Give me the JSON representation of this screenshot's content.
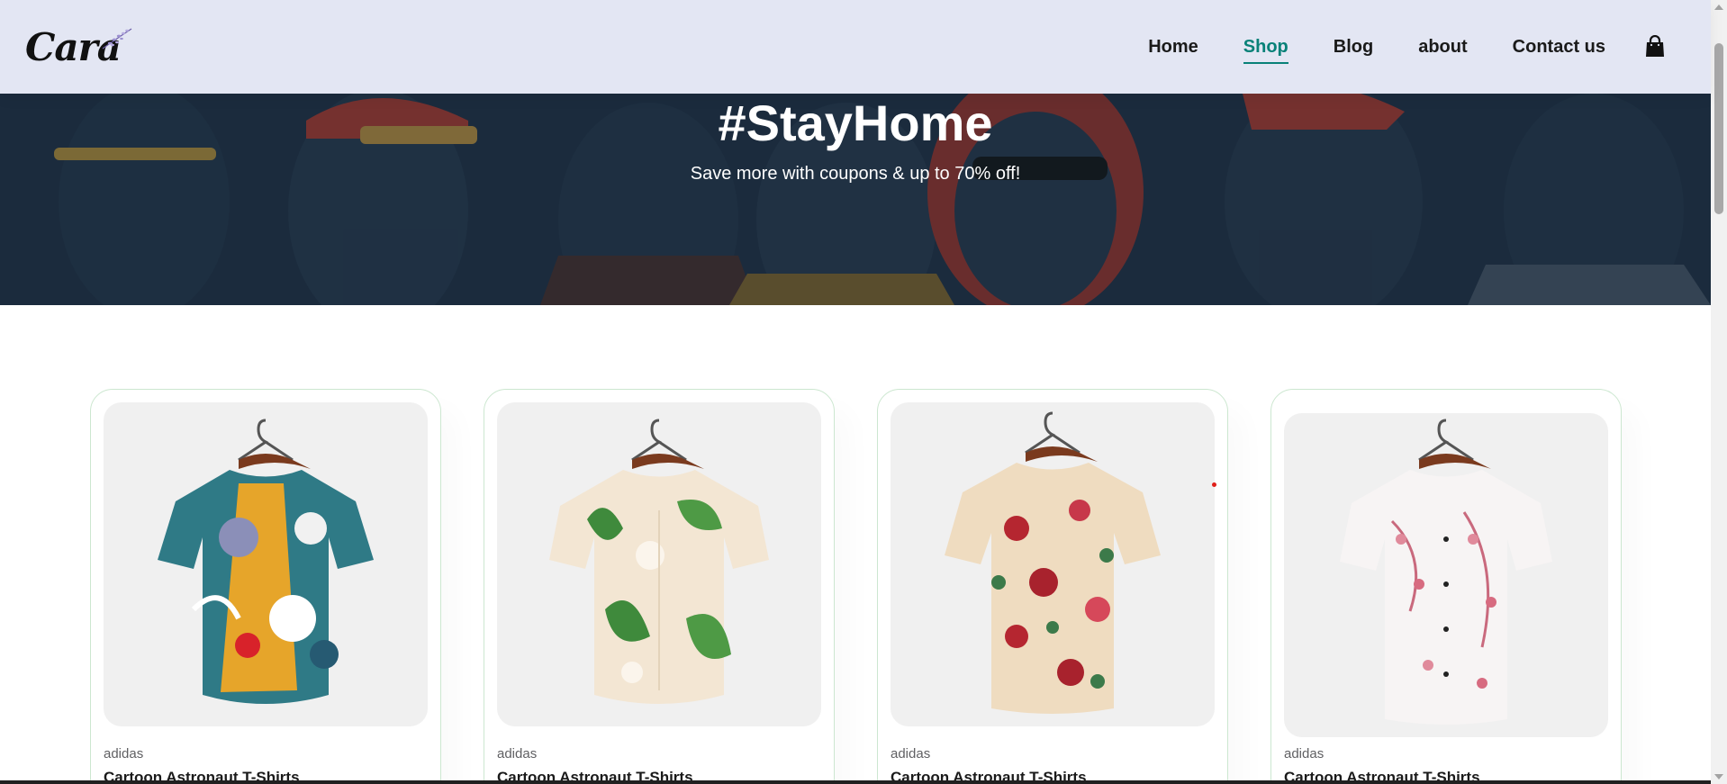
{
  "header": {
    "logo_text": "Cara",
    "nav": [
      {
        "label": "Home",
        "active": false
      },
      {
        "label": "Shop",
        "active": true
      },
      {
        "label": "Blog",
        "active": false
      },
      {
        "label": "about",
        "active": false
      },
      {
        "label": "Contact us",
        "active": false
      }
    ],
    "cart_icon": "shopping-bag-icon",
    "accent_color": "#088178",
    "background": "#e3e6f3"
  },
  "hero": {
    "title": "#StayHome",
    "subtitle": "Save more with coupons & up to 70% off!"
  },
  "products": [
    {
      "brand": "adidas",
      "name": "Cartoon Astronaut T-Shirts"
    },
    {
      "brand": "adidas",
      "name": "Cartoon Astronaut T-Shirts"
    },
    {
      "brand": "adidas",
      "name": "Cartoon Astronaut T-Shirts"
    },
    {
      "brand": "adidas",
      "name": "Cartoon Astronaut T-Shirts"
    }
  ]
}
